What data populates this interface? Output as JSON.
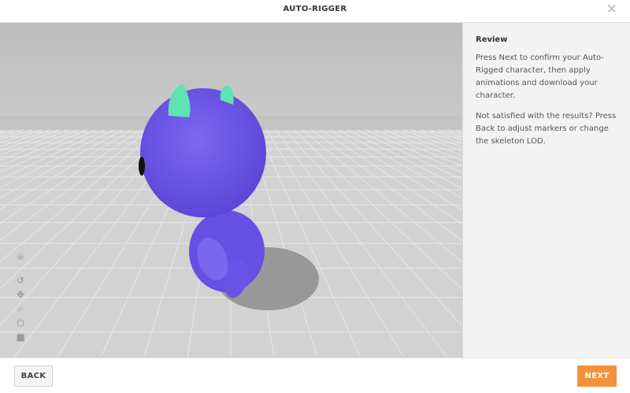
{
  "window": {
    "title": "AUTO-RIGGER",
    "close_glyph": "✕"
  },
  "panel": {
    "heading": "Review",
    "paragraph_1": "Press Next to confirm your Auto-Rigged character, then apply animations and download your character.",
    "paragraph_2": "Not satisfied with the results? Press Back to adjust markers or change the skeleton LOD."
  },
  "footer": {
    "back_label": "BACK",
    "next_label": "NEXT"
  },
  "viewport_tools": [
    {
      "name": "skull-icon",
      "glyph": "☠"
    },
    {
      "name": "rotate-icon",
      "glyph": "↺"
    },
    {
      "name": "move-icon",
      "glyph": "✥"
    },
    {
      "name": "zoom-icon",
      "glyph": "⌕"
    },
    {
      "name": "power-icon",
      "glyph": "⏻"
    },
    {
      "name": "camera-icon",
      "glyph": "■"
    }
  ],
  "colors": {
    "accent": "#f39239",
    "character_body": "#6c55e8",
    "character_horns": "#5fe3b0"
  }
}
